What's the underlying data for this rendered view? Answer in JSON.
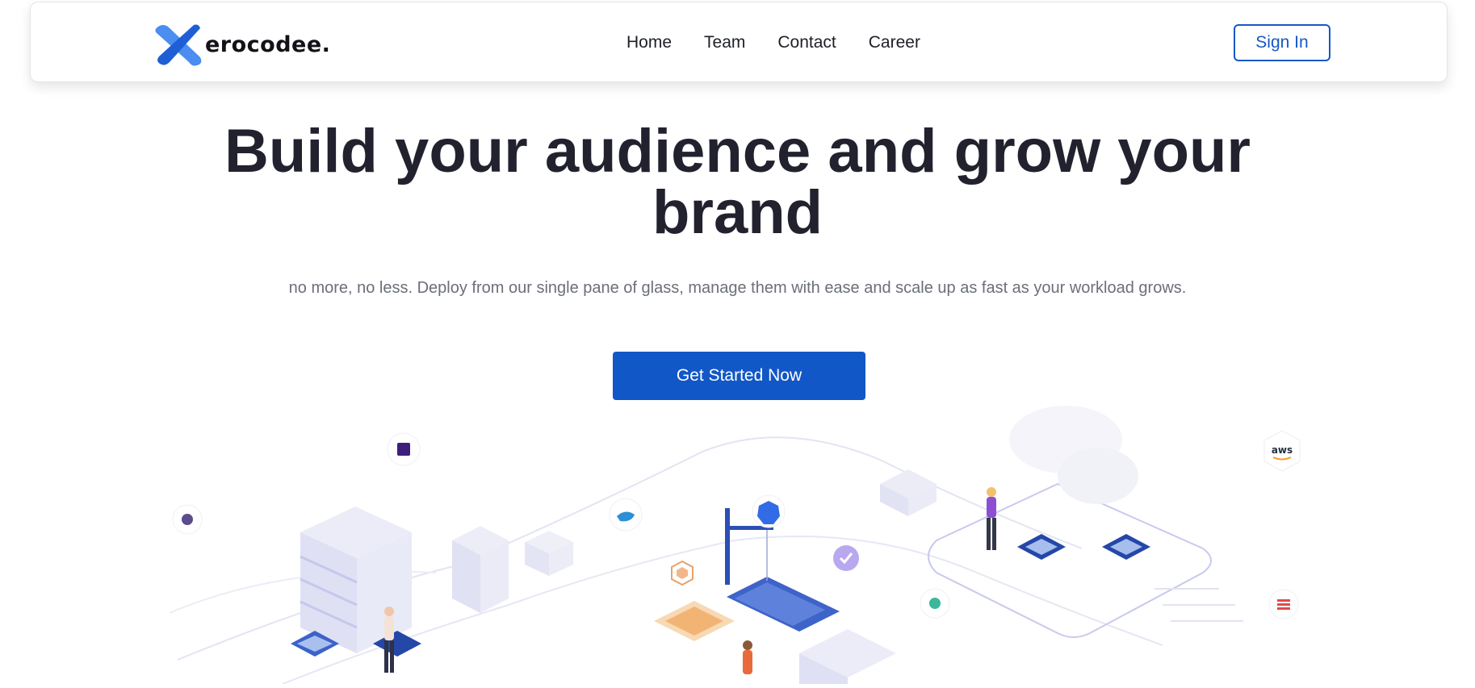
{
  "brand": {
    "logo_text": "erocodee.",
    "logo_mark_letter": "X",
    "colors": {
      "mark_primary": "#1f5fd6",
      "mark_secondary": "#4b8df0",
      "text": "#111317"
    }
  },
  "nav": {
    "links": [
      {
        "label": "Home"
      },
      {
        "label": "Team"
      },
      {
        "label": "Contact"
      },
      {
        "label": "Career"
      }
    ],
    "signin_label": "Sign In"
  },
  "hero": {
    "title": "Build your audience and grow your brand",
    "subtitle": "no more, no less. Deploy from our single pane of glass, manage them with ease and scale up as fast as your workload grows.",
    "cta_label": "Get Started Now"
  },
  "illustration": {
    "badges": [
      {
        "name": "aws-icon",
        "label": "aws"
      },
      {
        "name": "docker-icon"
      },
      {
        "name": "kubernetes-icon"
      },
      {
        "name": "app-grid-icon"
      },
      {
        "name": "globe-icon"
      },
      {
        "name": "server-list-icon"
      },
      {
        "name": "seal-icon"
      }
    ]
  },
  "colors": {
    "accent": "#1257c7",
    "title": "#22222f",
    "subtitle": "#6b6f78",
    "nav_text": "#1d1f26"
  }
}
